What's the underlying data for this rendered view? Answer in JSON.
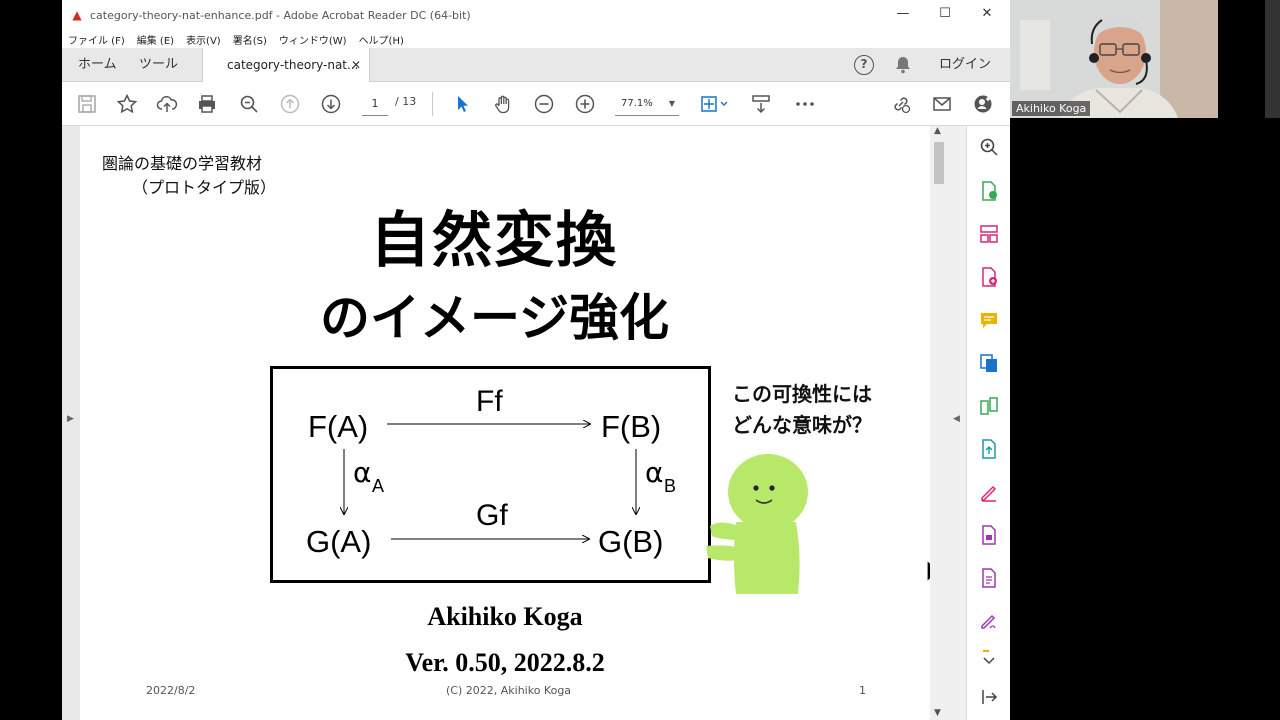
{
  "window": {
    "title": "category-theory-nat-enhance.pdf - Adobe Acrobat Reader DC (64-bit)",
    "controls": {
      "minimize": "—",
      "maximize": "☐",
      "close": "✕"
    }
  },
  "menubar": [
    "ファイル (F)",
    "編集 (E)",
    "表示(V)",
    "署名(S)",
    "ウィンドウ(W)",
    "ヘルプ(H)"
  ],
  "tabbar": {
    "home": "ホーム",
    "tools": "ツール",
    "doc_tab": "category-theory-nat...",
    "doc_tab_close": "✕",
    "help": "?",
    "login": "ログイン"
  },
  "toolbar": {
    "page_current": "1",
    "page_total": "/ 13",
    "zoom": "77.1%"
  },
  "page": {
    "subject_line1": "圏論の基礎の学習教材",
    "subject_line2": "（プロトタイプ版）",
    "title_line1": "自然変換",
    "title_line2": "のイメージ強化",
    "diagram": {
      "fa": "F(A)",
      "fb": "F(B)",
      "ga": "G(A)",
      "gb": "G(B)",
      "ff": "Ff",
      "gf": "Gf",
      "alpha_a": "α",
      "alpha_a_sub": "A",
      "alpha_b": "α",
      "alpha_b_sub": "B"
    },
    "speech_line1": "この可換性には",
    "speech_line2": "どんな意味が？",
    "author": "Akihiko Koga",
    "version": "Ver. 0.50, 2022.8.2",
    "footer_date": "2022/8/2",
    "footer_copyright": "(C) 2022, Akihiko Koga",
    "footer_page": "1"
  },
  "webcam": {
    "name": "Akihiko Koga"
  },
  "colors": {
    "acrobat_red": "#d12a1f",
    "tool_blue": "#1a73c8",
    "tool_green": "#3aa757",
    "tool_orange": "#e68a00",
    "tool_purple": "#9b3ab0",
    "tool_pink": "#d3297a",
    "character_green": "#b7e86a"
  }
}
